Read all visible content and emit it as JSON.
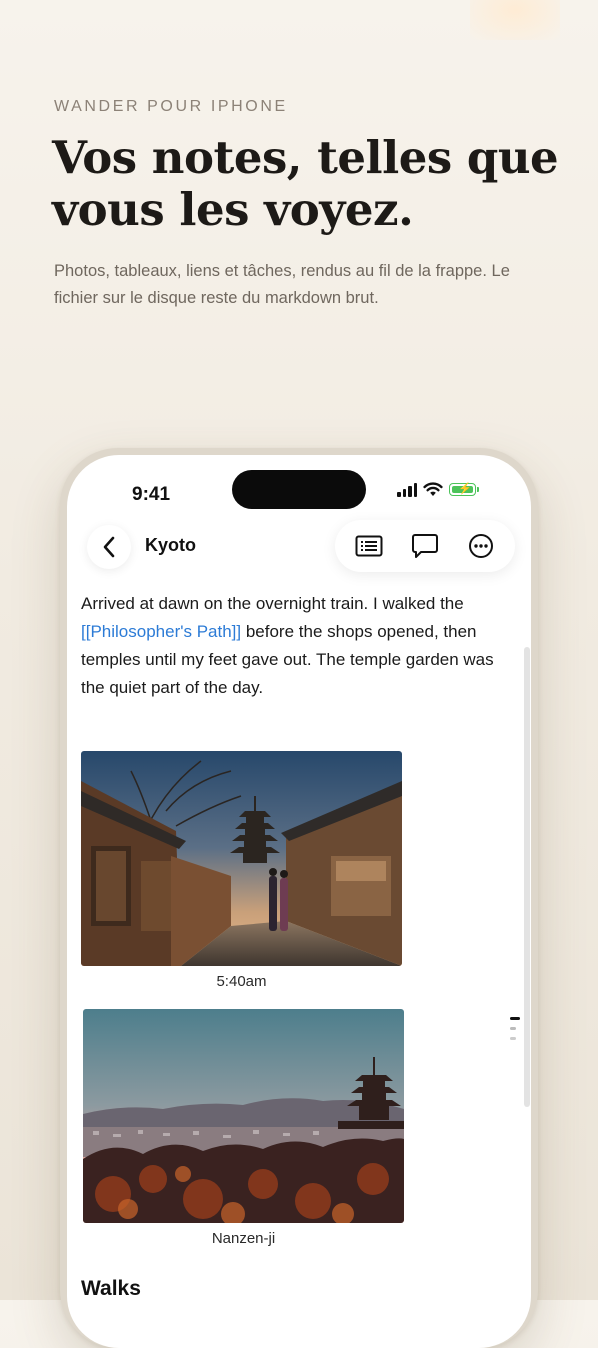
{
  "hero": {
    "eyebrow": "WANDER POUR IPHONE",
    "headline": "Vos notes, telles que vous les voyez.",
    "subtitle": "Photos, tableaux, liens et tâches, rendus au fil de la frappe. Le fichier sur le disque reste du markdown brut."
  },
  "status_bar": {
    "time": "9:41",
    "icons": [
      "cellular-signal-icon",
      "wifi-icon",
      "battery-charging-icon"
    ],
    "battery_color": "#4cc35a"
  },
  "nav": {
    "back_icon": "chevron-left-icon",
    "title": "Kyoto",
    "actions": [
      "outline-list-icon",
      "comment-bubble-icon",
      "more-ellipsis-icon"
    ]
  },
  "note": {
    "paragraph_before": "Arrived at dawn on the overnight train. I walked the ",
    "link": "[[Philosopher's Path]]",
    "paragraph_after": " before the shops opened, then temples until my feet gave out. The temple garden was the quiet part of the day.",
    "link_color": "#2c7bd6",
    "images": [
      {
        "caption": "5:40am",
        "subject": "kyoto-street-pagoda-dusk-photo"
      },
      {
        "caption": "Nanzen-ji",
        "subject": "kyoto-city-pagoda-sunset-photo"
      }
    ],
    "heading": "Walks"
  }
}
